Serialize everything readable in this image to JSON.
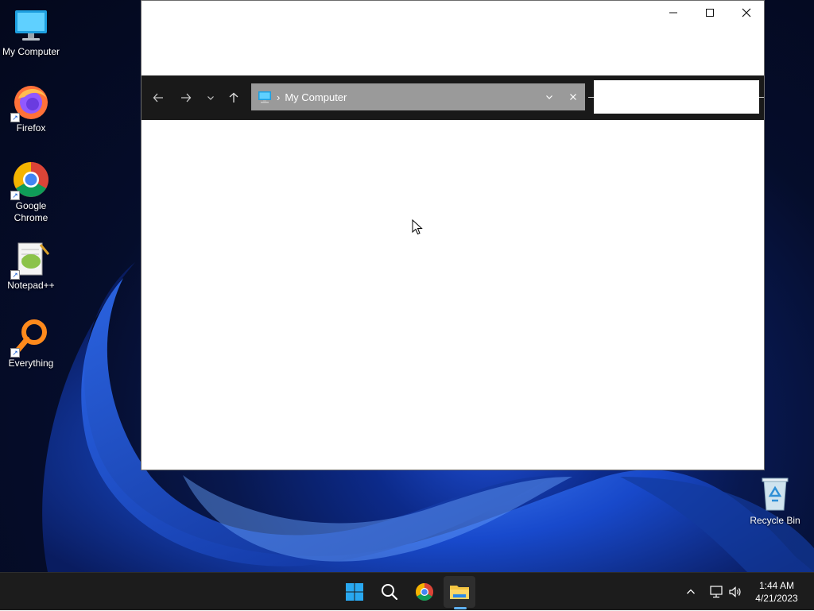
{
  "desktop": {
    "icons": [
      {
        "label": "My Computer",
        "icon": "computer-icon"
      },
      {
        "label": "Firefox",
        "icon": "firefox-icon"
      },
      {
        "label": "Google Chrome",
        "icon": "chrome-icon"
      },
      {
        "label": "Notepad++",
        "icon": "notepad-plus-plus-icon"
      },
      {
        "label": "Everything",
        "icon": "everything-search-icon"
      }
    ],
    "recycle_bin": {
      "label": "Recycle Bin",
      "icon": "recycle-bin-icon"
    }
  },
  "window": {
    "title": "",
    "controls": {
      "minimize": "minimize-icon",
      "maximize": "maximize-icon",
      "close": "close-icon"
    },
    "navigation": {
      "back": "back-arrow-icon",
      "forward": "forward-arrow-icon",
      "recent": "chevron-down-icon",
      "up": "up-arrow-icon"
    },
    "address": {
      "location": "My Computer",
      "icon": "computer-icon"
    },
    "search": {
      "value": ""
    }
  },
  "taskbar": {
    "apps": [
      "start-icon",
      "search-icon",
      "chrome-icon",
      "file-explorer-icon"
    ],
    "active_app": "file-explorer-icon",
    "tray": [
      "chevron-up-icon",
      "network-icon",
      "volume-icon"
    ],
    "clock": {
      "time": "1:44 AM",
      "date": "4/21/2023"
    }
  },
  "colors": {
    "taskbar_bg": "#1c1c1c",
    "nav_bar_bg": "#191919",
    "address_bg": "#9a9a9a",
    "active_indicator": "#5fb2f2"
  }
}
